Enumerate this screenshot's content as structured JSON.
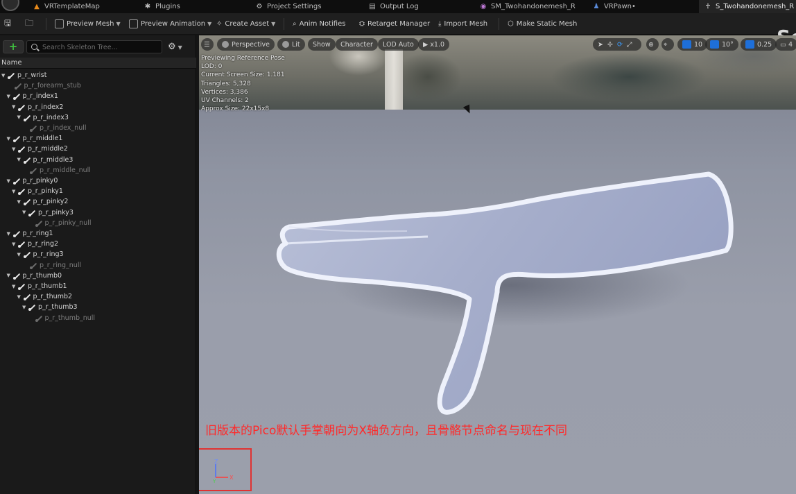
{
  "tabs": [
    {
      "label": "VRTemplateMap",
      "icon": "level-icon",
      "color": "#e88a1a"
    },
    {
      "label": "Plugins",
      "icon": "plugin-icon",
      "color": "#bdbdbd"
    },
    {
      "label": "Project Settings",
      "icon": "settings-icon",
      "color": "#bdbdbd"
    },
    {
      "label": "Output Log",
      "icon": "log-icon",
      "color": "#bdbdbd"
    },
    {
      "label": "SM_Twohandonemesh_R",
      "icon": "static-mesh-icon",
      "color": "#c07ad8"
    },
    {
      "label": "VRPawn•",
      "icon": "blueprint-icon",
      "color": "#5a8ad8"
    },
    {
      "label": "S_Twohandonemesh_R",
      "icon": "skeleton-icon",
      "color": "#c7c7c7"
    }
  ],
  "toolbar": {
    "preview_mesh": "Preview Mesh",
    "preview_animation": "Preview Animation",
    "create_asset": "Create Asset",
    "anim_notifies": "Anim Notifies",
    "retarget_manager": "Retarget Manager",
    "import_mesh": "Import Mesh",
    "make_static_mesh": "Make Static Mesh",
    "editor_title_fragment": "Se"
  },
  "skeleton_tree": {
    "search_placeholder": "Search Skeleton Tree...",
    "column_header": "Name",
    "bones": [
      {
        "name": "p_r_wrist",
        "depth": 0,
        "expanded": true,
        "null": false
      },
      {
        "name": "p_r_forearm_stub",
        "depth": 1,
        "expanded": false,
        "null": true
      },
      {
        "name": "p_r_index1",
        "depth": 1,
        "expanded": true,
        "null": false
      },
      {
        "name": "p_r_index2",
        "depth": 2,
        "expanded": true,
        "null": false
      },
      {
        "name": "p_r_index3",
        "depth": 3,
        "expanded": true,
        "null": false
      },
      {
        "name": "p_r_index_null",
        "depth": 4,
        "expanded": false,
        "null": true
      },
      {
        "name": "p_r_middle1",
        "depth": 1,
        "expanded": true,
        "null": false
      },
      {
        "name": "p_r_middle2",
        "depth": 2,
        "expanded": true,
        "null": false
      },
      {
        "name": "p_r_middle3",
        "depth": 3,
        "expanded": true,
        "null": false
      },
      {
        "name": "p_r_middle_null",
        "depth": 4,
        "expanded": false,
        "null": true
      },
      {
        "name": "p_r_pinky0",
        "depth": 1,
        "expanded": true,
        "null": false
      },
      {
        "name": "p_r_pinky1",
        "depth": 2,
        "expanded": true,
        "null": false
      },
      {
        "name": "p_r_pinky2",
        "depth": 3,
        "expanded": true,
        "null": false
      },
      {
        "name": "p_r_pinky3",
        "depth": 4,
        "expanded": true,
        "null": false
      },
      {
        "name": "p_r_pinky_null",
        "depth": 5,
        "expanded": false,
        "null": true
      },
      {
        "name": "p_r_ring1",
        "depth": 1,
        "expanded": true,
        "null": false
      },
      {
        "name": "p_r_ring2",
        "depth": 2,
        "expanded": true,
        "null": false
      },
      {
        "name": "p_r_ring3",
        "depth": 3,
        "expanded": true,
        "null": false
      },
      {
        "name": "p_r_ring_null",
        "depth": 4,
        "expanded": false,
        "null": true
      },
      {
        "name": "p_r_thumb0",
        "depth": 1,
        "expanded": true,
        "null": false
      },
      {
        "name": "p_r_thumb1",
        "depth": 2,
        "expanded": true,
        "null": false
      },
      {
        "name": "p_r_thumb2",
        "depth": 3,
        "expanded": true,
        "null": false
      },
      {
        "name": "p_r_thumb3",
        "depth": 4,
        "expanded": true,
        "null": false
      },
      {
        "name": "p_r_thumb_null",
        "depth": 5,
        "expanded": false,
        "null": true
      }
    ]
  },
  "viewport": {
    "perspective": "Perspective",
    "lit": "Lit",
    "show": "Show",
    "character": "Character",
    "lod": "LOD Auto",
    "play_speed": "x1.0",
    "grid_snap": "10",
    "rotation_snap": "10°",
    "scale_snap": "0.25",
    "camera_speed": "4",
    "stats": [
      "Previewing Reference Pose",
      "LOD: 0",
      "Current Screen Size: 1.181",
      "Triangles: 5,328",
      "Vertices: 3,386",
      "UV Channels: 2",
      "Approx Size: 22x15x8"
    ],
    "axis_labels": {
      "z": "Z",
      "x": "X",
      "y": "Y"
    }
  },
  "annotation": {
    "caption": "旧版本的Pico默认手掌朝向为X轴负方向，且骨骼节点命名与现在不同",
    "color": "#ff2a2a"
  }
}
